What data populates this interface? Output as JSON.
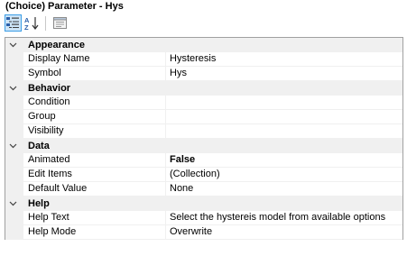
{
  "window": {
    "title": "(Choice) Parameter - Hys"
  },
  "toolbar": {
    "categorized_icon": "categorized-view-icon",
    "alphabetical_icon": "alphabetical-sort-icon",
    "property_pages_icon": "property-pages-icon"
  },
  "grid": {
    "categories": [
      {
        "name": "Appearance",
        "properties": [
          {
            "name": "Display Name",
            "value": "Hysteresis"
          },
          {
            "name": "Symbol",
            "value": "Hys"
          }
        ]
      },
      {
        "name": "Behavior",
        "properties": [
          {
            "name": "Condition",
            "value": ""
          },
          {
            "name": "Group",
            "value": ""
          },
          {
            "name": "Visibility",
            "value": ""
          }
        ]
      },
      {
        "name": "Data",
        "properties": [
          {
            "name": "Animated",
            "value": "False",
            "bold": true
          },
          {
            "name": "Edit Items",
            "value": "(Collection)"
          },
          {
            "name": "Default Value",
            "value": "None"
          }
        ]
      },
      {
        "name": "Help",
        "properties": [
          {
            "name": "Help Text",
            "value": "Select the hystereis model from available options"
          },
          {
            "name": "Help Mode",
            "value": "Overwrite"
          }
        ]
      }
    ]
  },
  "colors": {
    "category_bg": "#f0f0f0",
    "selected_button_bg": "#cce4f7",
    "selected_button_border": "#3c9ee6",
    "grid_border": "#a0a0a0"
  }
}
